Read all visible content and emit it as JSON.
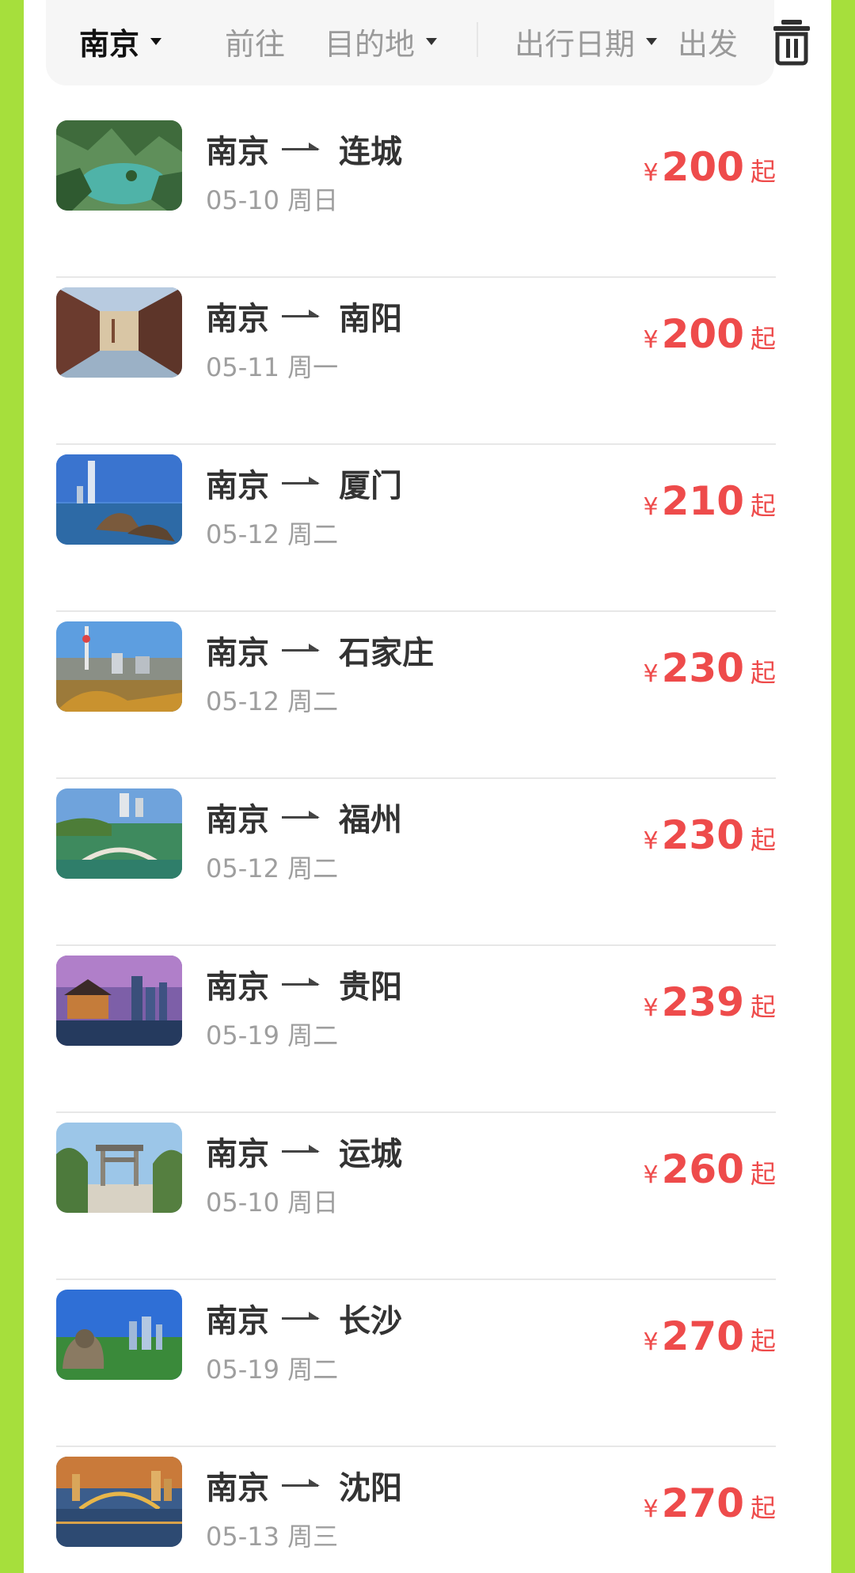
{
  "filters": {
    "origin": "南京",
    "via": "前往",
    "destination": "目的地",
    "date": "出行日期",
    "depart": "出发"
  },
  "icons": {
    "dropdown": "chevron-down-icon",
    "delete": "trash-icon",
    "route_arrow": "arrow-right-icon"
  },
  "colors": {
    "frame_green": "#a6df3c",
    "price_red": "#ee4b4b"
  },
  "routes": [
    {
      "from": "南京",
      "to": "连城",
      "date": "05-10 周日",
      "currency": "¥",
      "price": "200",
      "suffix": "起",
      "thumb": "karst-bay-photo"
    },
    {
      "from": "南京",
      "to": "南阳",
      "date": "05-11 周一",
      "currency": "¥",
      "price": "200",
      "suffix": "起",
      "thumb": "old-street-photo"
    },
    {
      "from": "南京",
      "to": "厦门",
      "date": "05-12 周二",
      "currency": "¥",
      "price": "210",
      "suffix": "起",
      "thumb": "seaside-tower-photo"
    },
    {
      "from": "南京",
      "to": "石家庄",
      "date": "05-12 周二",
      "currency": "¥",
      "price": "230",
      "suffix": "起",
      "thumb": "city-skyline-photo"
    },
    {
      "from": "南京",
      "to": "福州",
      "date": "05-12 周二",
      "currency": "¥",
      "price": "230",
      "suffix": "起",
      "thumb": "stone-bridge-photo"
    },
    {
      "from": "南京",
      "to": "贵阳",
      "date": "05-19 周二",
      "currency": "¥",
      "price": "239",
      "suffix": "起",
      "thumb": "night-pavilion-photo"
    },
    {
      "from": "南京",
      "to": "运城",
      "date": "05-10 周日",
      "currency": "¥",
      "price": "260",
      "suffix": "起",
      "thumb": "memorial-archway-photo"
    },
    {
      "from": "南京",
      "to": "长沙",
      "date": "05-19 周二",
      "currency": "¥",
      "price": "270",
      "suffix": "起",
      "thumb": "statue-skyline-photo"
    },
    {
      "from": "南京",
      "to": "沈阳",
      "date": "05-13 周三",
      "currency": "¥",
      "price": "270",
      "suffix": "起",
      "thumb": "river-bridge-photo"
    }
  ]
}
